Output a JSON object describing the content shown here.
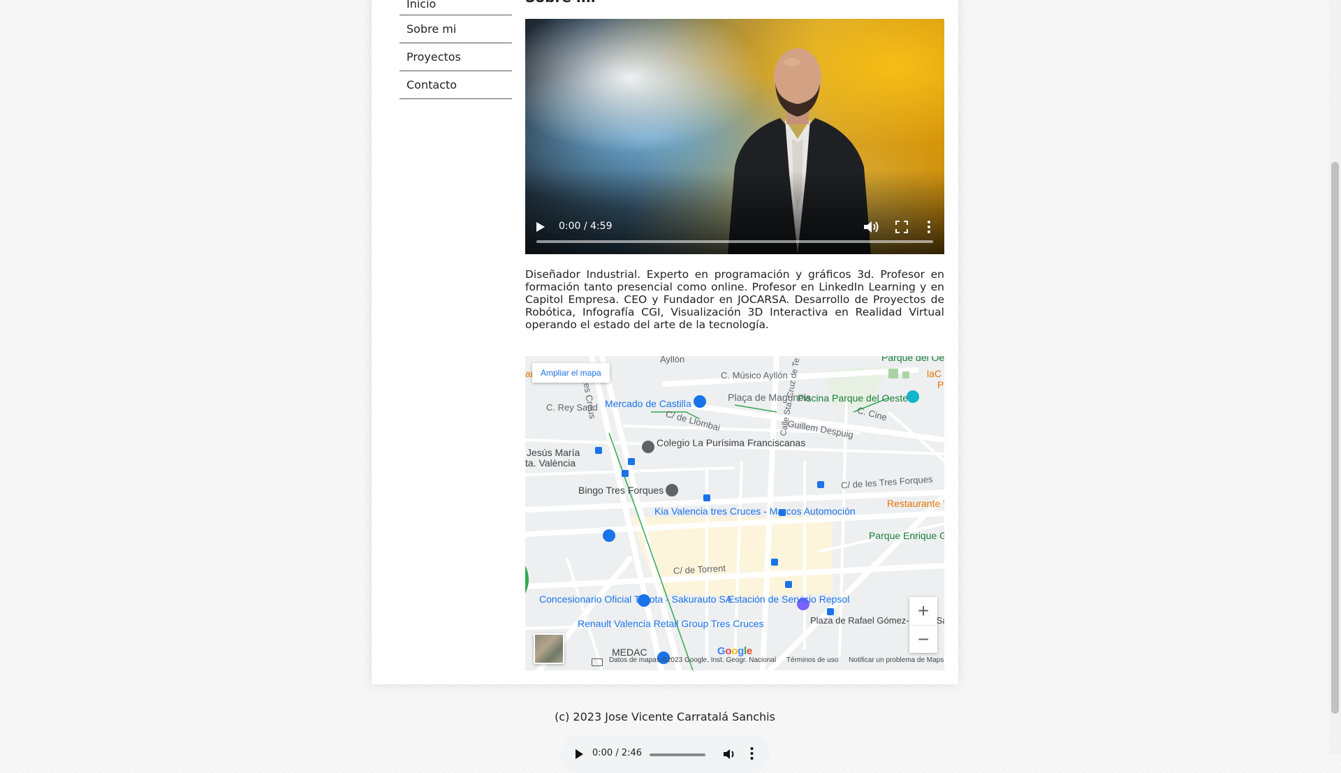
{
  "nav": {
    "items": [
      "Inicio",
      "Sobre mi",
      "Proyectos",
      "Contacto"
    ]
  },
  "section": {
    "title": "Sobre mi"
  },
  "video": {
    "time": "0:00 / 4:59",
    "progress": 0
  },
  "bio": "Diseñador Industrial. Experto en programación y gráficos 3d. Profesor en formación tanto presencial como online. Profesor en LinkedIn Learning y en Capitol Empresa. CEO y Fundador en JOCARSA. Desarrollo de Proyectos de Robótica, Infografía CGI, Visualización 3D Interactiva en Realidad Virtual operando el estado del arte de la tecnología.",
  "map": {
    "enlarge_label": "Ampliar el mapa",
    "labels": {
      "musico_aylon": "C. Músico Ayllón",
      "aylon_top": "Ayllón",
      "creus": "Les Creus",
      "rey_saud": "C. Rey Saud",
      "mercado": "Mercado de Castilla",
      "placa_maguncia": "Plaça de Magúncia",
      "cruz_de_te": "Calle Sta. Cruz de Te",
      "piscina": "Piscina Parque del Oeste",
      "parque_oeste_top": "Parque del Oeste",
      "llombai": "C/ de Llombai",
      "guillem": "Guillem Despuig",
      "cine": "C. Cine",
      "colegio": "Colegio La Purísima Franciscanas",
      "jesus_maria": "Jesús María",
      "sta_valencia": "ta. València",
      "bingo": "Bingo Tres Forques",
      "tres_forques_st": "C/ de les Tres Forques",
      "kia": "Kia Valencia tres Cruces - Marcos Automoción",
      "restaurante": "Restaurante Y",
      "parque_enrique": "Parque Enrique Gr",
      "torrent": "C/ de Torrent",
      "toyota": "Concesionario Oficial Toyota - Sakurauto SA",
      "repsol": "Estación de Servicio Repsol",
      "renault": "Renault Valencia Retail Group Tres Cruces",
      "medac": "MEDAC",
      "placa_rafael": "Plaza de Rafael Gómez-Ferrer Sapiña (Notario)",
      "ar_left": "ar",
      "lac_right": "laC",
      "p_right": "P"
    },
    "zoom_in": "+",
    "zoom_out": "−",
    "google_logo": "Google",
    "attribution": {
      "data": "Datos de mapas ©2023 Google, Inst. Geogr. Nacional",
      "terms": "Términos de uso",
      "report": "Notificar un problema de Maps"
    }
  },
  "footer": {
    "copyright": "(c) 2023 Jose Vicente Carratalá Sanchis"
  },
  "audio": {
    "time": "0:00 / 2:46"
  }
}
